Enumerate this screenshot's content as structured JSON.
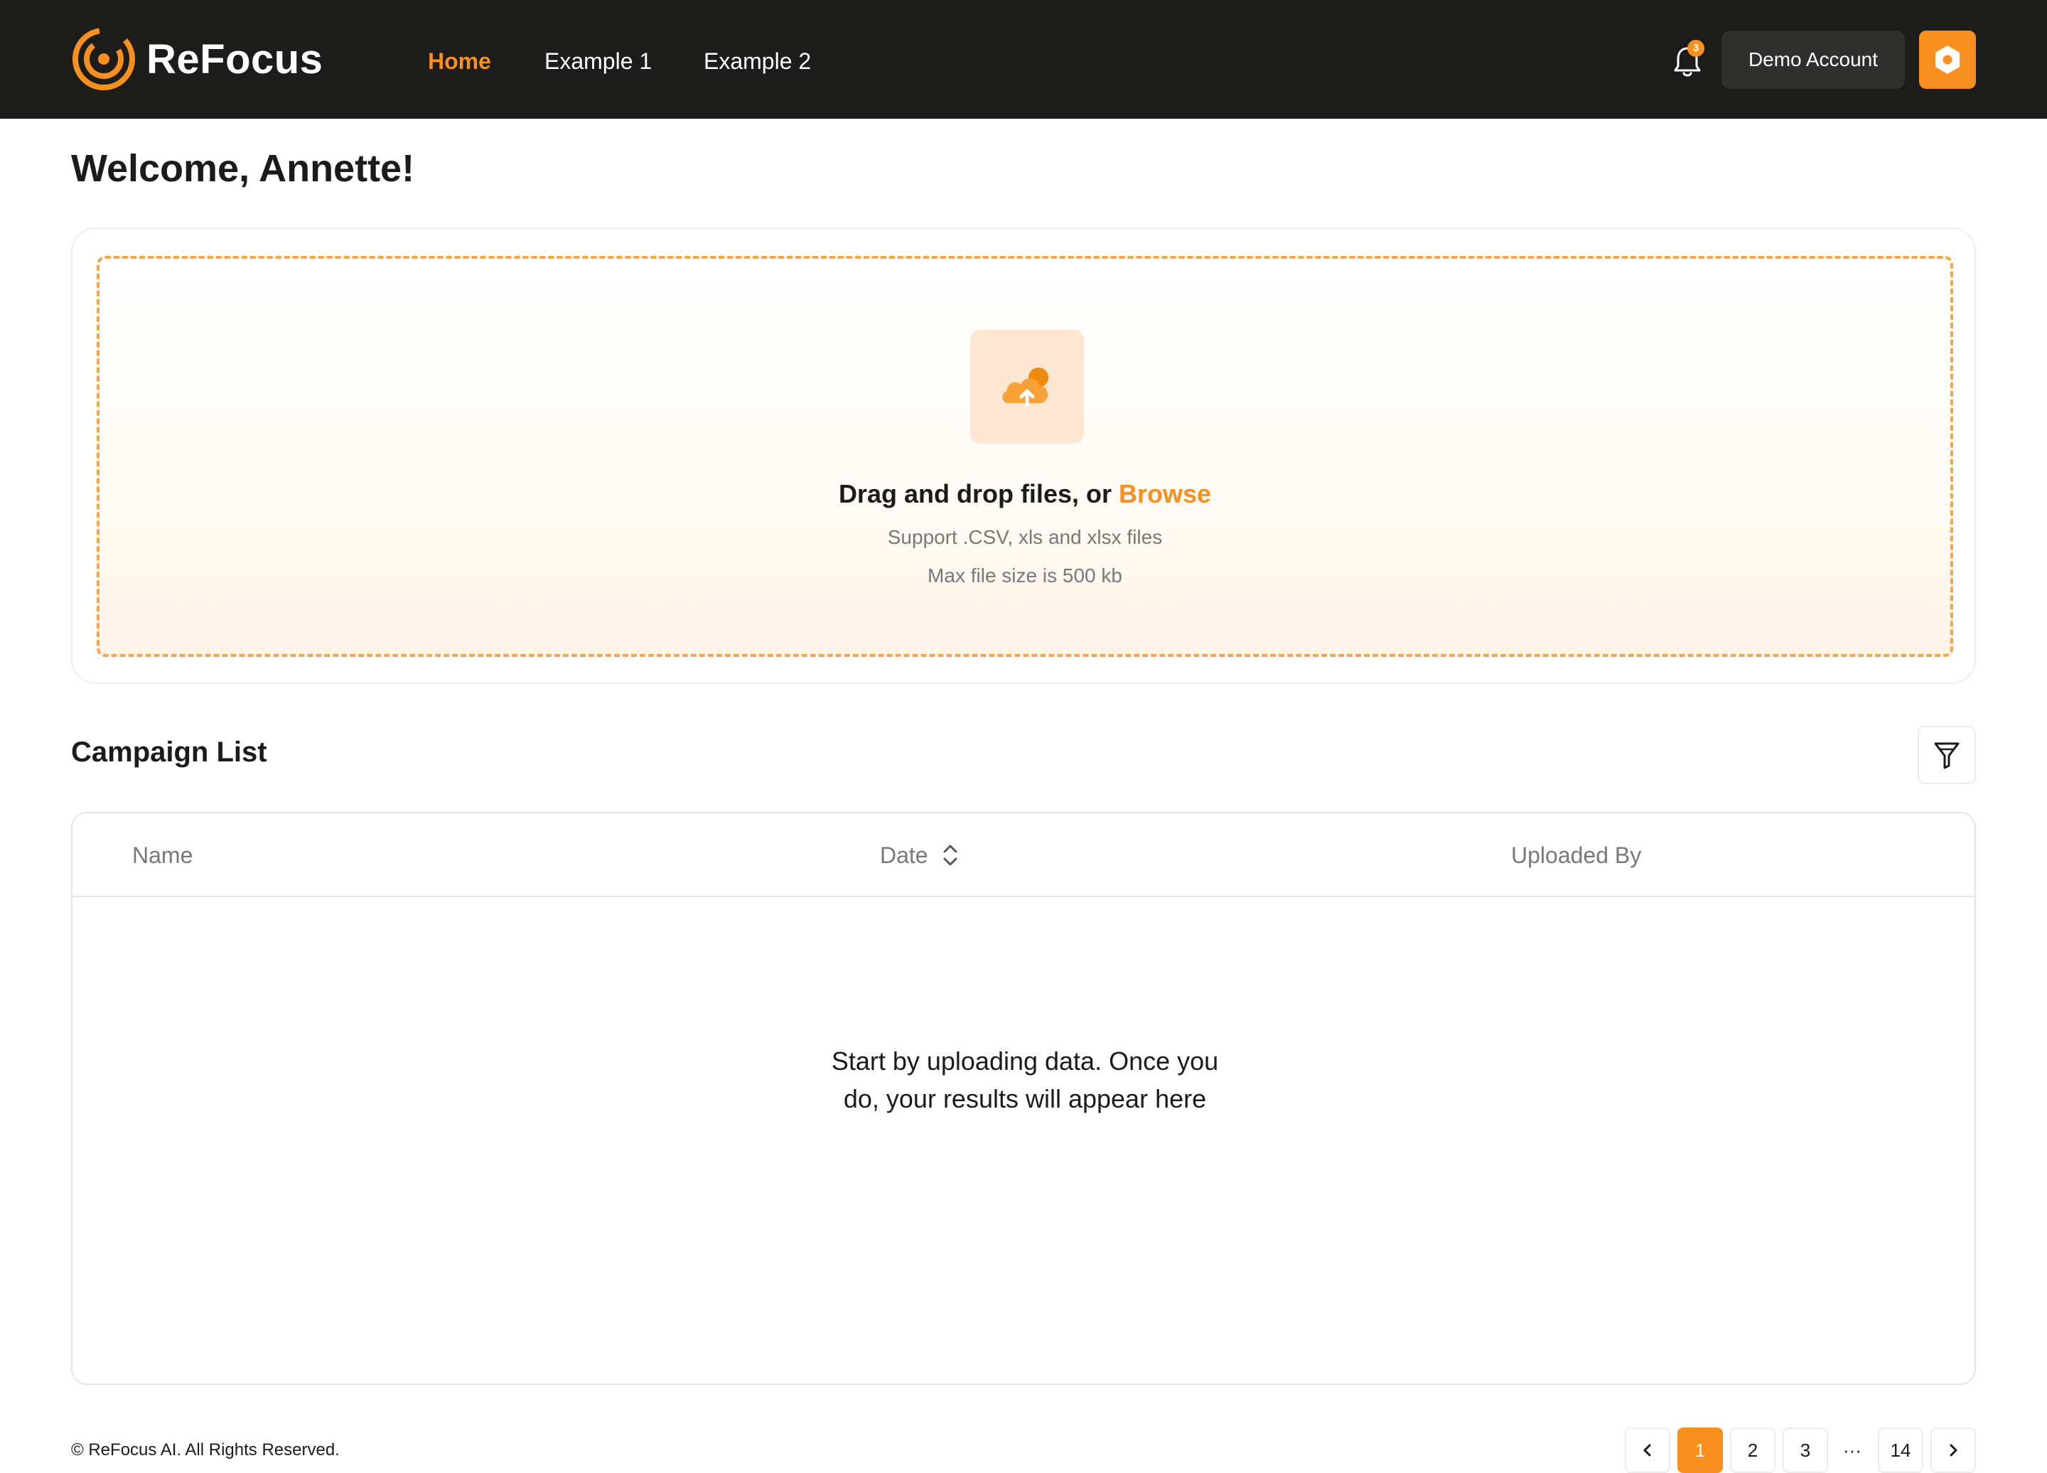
{
  "brand": {
    "name": "ReFocus",
    "accent_color": "#f7901e",
    "logo_icon": "refocus-logo-icon"
  },
  "nav": {
    "links": [
      {
        "label": "Home",
        "active": true
      },
      {
        "label": "Example 1",
        "active": false
      },
      {
        "label": "Example 2",
        "active": false
      }
    ],
    "notifications": {
      "icon": "bell-icon",
      "count": "3"
    },
    "account_button": "Demo Account",
    "avatar_icon": "hexagon-icon"
  },
  "welcome": {
    "title": "Welcome, Annette!"
  },
  "upload": {
    "icon": "cloud-upload-icon",
    "title_prefix": "Drag and drop files, or ",
    "browse_label": "Browse",
    "support_text": "Support .CSV, xls and xlsx files",
    "max_size_text": "Max file size is 500 kb"
  },
  "campaigns": {
    "title": "Campaign List",
    "filter_icon": "filter-icon",
    "columns": [
      "Name",
      "Date",
      "Uploaded By"
    ],
    "sort_icon": "sort-icon",
    "empty_message": "Start by uploading data. Once you do, your results will appear here"
  },
  "footer": {
    "copyright": "© ReFocus AI. All Rights Reserved."
  },
  "pagination": {
    "prev_icon": "chevron-left-icon",
    "next_icon": "chevron-right-icon",
    "pages": [
      "1",
      "2",
      "3",
      "14"
    ],
    "ellipsis": "···",
    "current": "1"
  }
}
